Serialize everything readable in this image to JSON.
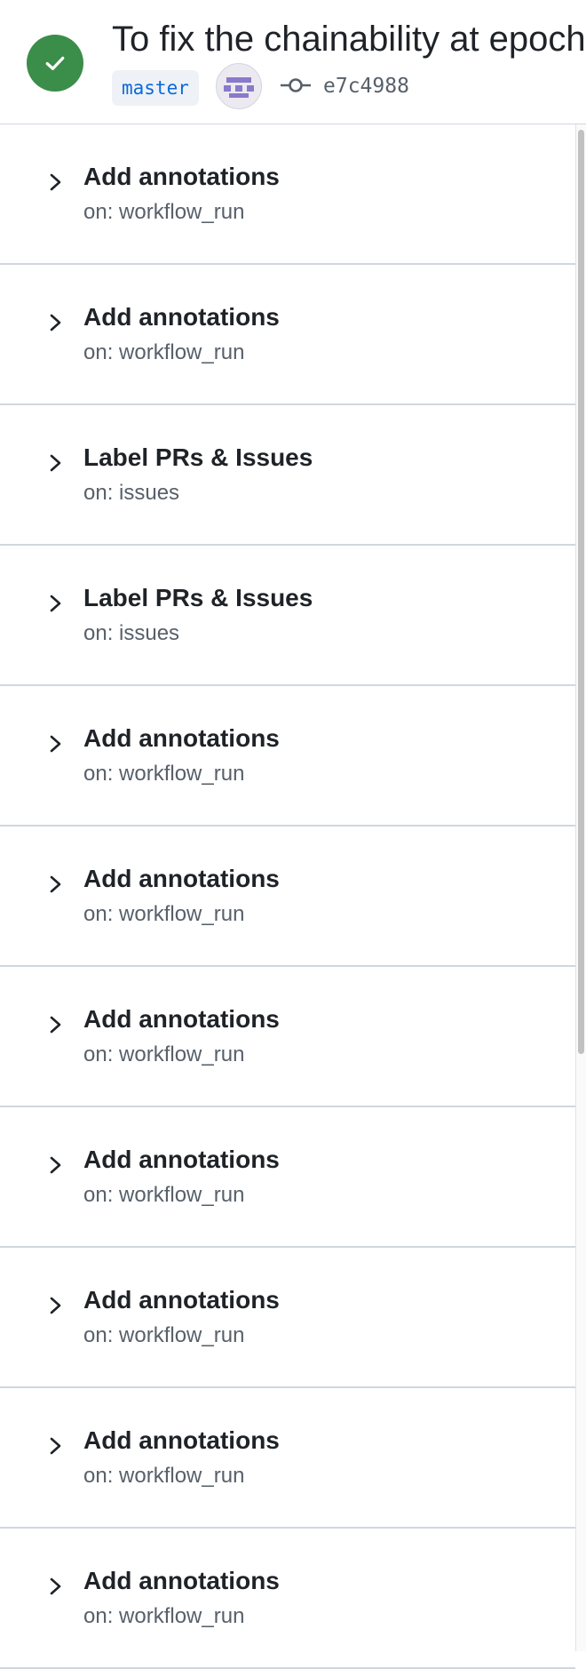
{
  "header": {
    "title": "To fix the chainability at epoch",
    "branch": "master",
    "commit_sha": "e7c4988",
    "status": "success",
    "status_color": "#3b8d4a",
    "status_icon": "check-icon",
    "avatar_icon": "identicon-avatar",
    "commit_icon": "git-commit-icon"
  },
  "runs": [
    {
      "title": "Add annotations",
      "trigger": "on: workflow_run"
    },
    {
      "title": "Add annotations",
      "trigger": "on: workflow_run"
    },
    {
      "title": "Label PRs & Issues",
      "trigger": "on: issues"
    },
    {
      "title": "Label PRs & Issues",
      "trigger": "on: issues"
    },
    {
      "title": "Add annotations",
      "trigger": "on: workflow_run"
    },
    {
      "title": "Add annotations",
      "trigger": "on: workflow_run"
    },
    {
      "title": "Add annotations",
      "trigger": "on: workflow_run"
    },
    {
      "title": "Add annotations",
      "trigger": "on: workflow_run"
    },
    {
      "title": "Add annotations",
      "trigger": "on: workflow_run"
    },
    {
      "title": "Add annotations",
      "trigger": "on: workflow_run"
    },
    {
      "title": "Add annotations",
      "trigger": "on: workflow_run"
    }
  ]
}
